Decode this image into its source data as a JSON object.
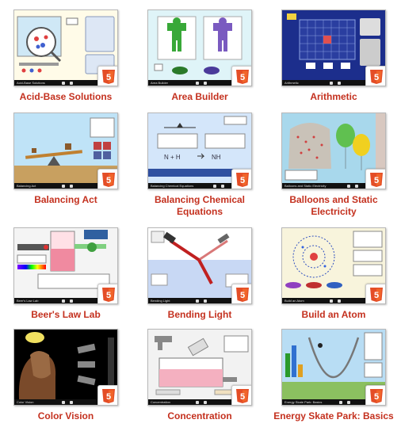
{
  "badge": {
    "label": "5",
    "color": "#e44d26"
  },
  "sims": [
    {
      "title": "Acid-Base Solutions",
      "footer": "Acid-Base Solutions",
      "icon": "html5-icon"
    },
    {
      "title": "Area Builder",
      "footer": "Area Builder",
      "icon": "html5-icon"
    },
    {
      "title": "Arithmetic",
      "footer": "Arithmetic",
      "icon": "html5-icon"
    },
    {
      "title": "Balancing Act",
      "footer": "Balancing Act",
      "icon": "html5-icon"
    },
    {
      "title": "Balancing Chemical Equations",
      "footer": "Balancing Chemical Equations",
      "icon": "html5-icon"
    },
    {
      "title": "Balloons and Static Electricity",
      "footer": "Balloons and Static Electricity",
      "icon": "html5-icon"
    },
    {
      "title": "Beer's Law Lab",
      "footer": "Beer's Law Lab",
      "icon": "html5-icon"
    },
    {
      "title": "Bending Light",
      "footer": "Bending Light",
      "icon": "html5-icon"
    },
    {
      "title": "Build an Atom",
      "footer": "Build an Atom",
      "icon": "html5-icon"
    },
    {
      "title": "Color Vision",
      "footer": "Color Vision",
      "icon": "html5-icon"
    },
    {
      "title": "Concentration",
      "footer": "Concentration",
      "icon": "html5-icon"
    },
    {
      "title": "Energy Skate Park: Basics",
      "footer": "Energy Skate Park: Basics",
      "icon": "html5-icon"
    }
  ]
}
